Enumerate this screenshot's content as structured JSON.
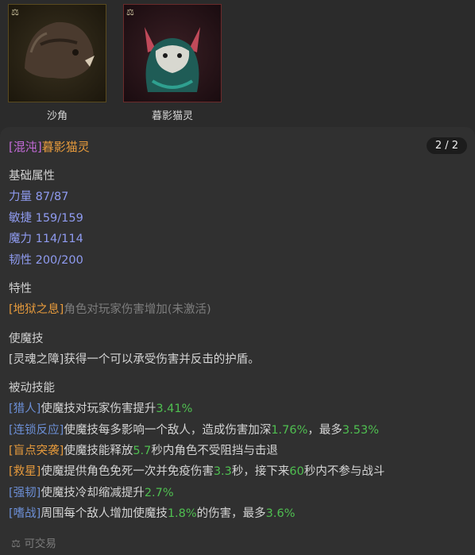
{
  "pets": [
    {
      "name": "沙角",
      "rank_icon": "scale-icon"
    },
    {
      "name": "暮影猫灵",
      "rank_icon": "scale-icon"
    }
  ],
  "panel": {
    "title_tag": "[混沌]",
    "title_name": "暮影猫灵",
    "page": "2 / 2",
    "base_attr_title": "基础属性",
    "stats": [
      "力量 87/87",
      "敏捷 159/159",
      "魔力 114/114",
      "韧性 200/200"
    ],
    "trait_title": "特性",
    "trait": {
      "tag": "[地狱之息]",
      "text": "角色对玩家伤害增加(未激活)"
    },
    "skill_title": "使魔技",
    "skill_text": "[灵魂之障]获得一个可以承受伤害并反击的护盾。",
    "passive_title": "被动技能",
    "passives": [
      {
        "tag": "[猎人]",
        "parts": [
          "使魔技对玩家伤害提升",
          "3.41%"
        ]
      },
      {
        "tag": "[连锁反应]",
        "parts": [
          "使魔技每多影响一个敌人，造成伤害加深",
          "1.76%",
          "，最多",
          "3.53%"
        ]
      },
      {
        "tag": "[盲点突袭]",
        "parts": [
          "使魔技能释放",
          "5.7",
          "秒内角色不受阻挡与击退"
        ]
      },
      {
        "tag": "[救星]",
        "parts": [
          "使魔提供角色免死一次并免疫伤害",
          "3.3",
          "秒，接下来",
          "60",
          "秒内不参与战斗"
        ]
      },
      {
        "tag": "[强韧]",
        "parts": [
          "使魔技冷却缩减提升",
          "2.7%"
        ]
      },
      {
        "tag": "[嗜战]",
        "parts": [
          "周围每个敌人增加使魔技",
          "1.8%",
          "的伤害，最多",
          "3.6%"
        ]
      }
    ],
    "footer": "可交易",
    "footer_icon": "scale-icon"
  }
}
